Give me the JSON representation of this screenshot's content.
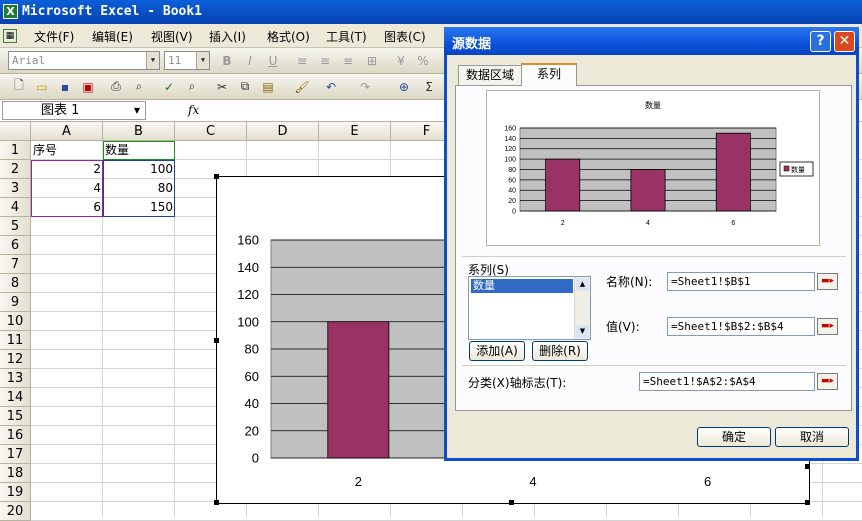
{
  "excel": {
    "title": "Microsoft Excel - Book1",
    "app_icon": "X",
    "menu": [
      {
        "label": "文件(F)"
      },
      {
        "label": "编辑(E)"
      },
      {
        "label": "视图(V)"
      },
      {
        "label": "插入(I)"
      },
      {
        "label": "格式(O)"
      },
      {
        "label": "工具(T)"
      },
      {
        "label": "图表(C)"
      }
    ],
    "font_name": "Arial",
    "font_size": "11",
    "name_box": "图表 1",
    "fx": "fx",
    "columns": [
      "A",
      "B",
      "C",
      "D",
      "E",
      "F"
    ],
    "rows": [
      "1",
      "2",
      "3",
      "4",
      "5",
      "6",
      "7",
      "8",
      "9",
      "10",
      "11",
      "12",
      "13",
      "14",
      "15",
      "16",
      "17",
      "18",
      "19",
      "20"
    ],
    "cells": {
      "A1": "序号",
      "B1": "数量",
      "A2": "2",
      "B2": "100",
      "A3": "4",
      "B3": "80",
      "A4": "6",
      "B4": "150"
    }
  },
  "embedded_chart": {
    "type": "bar",
    "categories": [
      "2",
      "4",
      "6"
    ],
    "values": [
      100,
      80,
      150
    ],
    "ylim": [
      0,
      160
    ],
    "yticks": [
      "0",
      "20",
      "40",
      "60",
      "80",
      "100",
      "120",
      "140",
      "160"
    ],
    "grid": true,
    "bar_color": "#993366",
    "plot_bg": "#c0c0c0"
  },
  "dialog": {
    "title": "源数据",
    "help_btn": "?",
    "close_btn": "✕",
    "tabs": [
      "数据区域",
      "系列"
    ],
    "active_tab": "系列",
    "series_label": "系列(S)",
    "series_items": [
      "数量"
    ],
    "add_btn": "添加(A)",
    "remove_btn": "删除(R)",
    "name_label": "名称(N):",
    "name_value": "=Sheet1!$B$1",
    "values_label": "值(V):",
    "values_value": "=Sheet1!$B$2:$B$4",
    "category_label": "分类(X)轴标志(T):",
    "category_value": "=Sheet1!$A$2:$A$4",
    "ok_btn": "确定",
    "cancel_btn": "取消"
  },
  "chart_data": {
    "type": "bar",
    "title": "数量",
    "categories": [
      "2",
      "4",
      "6"
    ],
    "series": [
      {
        "name": "数量",
        "values": [
          100,
          80,
          150
        ]
      }
    ],
    "ylim": [
      0,
      160
    ],
    "yticks": [
      "0",
      "20",
      "40",
      "60",
      "80",
      "100",
      "120",
      "140",
      "160"
    ],
    "grid": true,
    "legend": "right",
    "bar_color": "#993366",
    "plot_bg": "#c0c0c0"
  }
}
